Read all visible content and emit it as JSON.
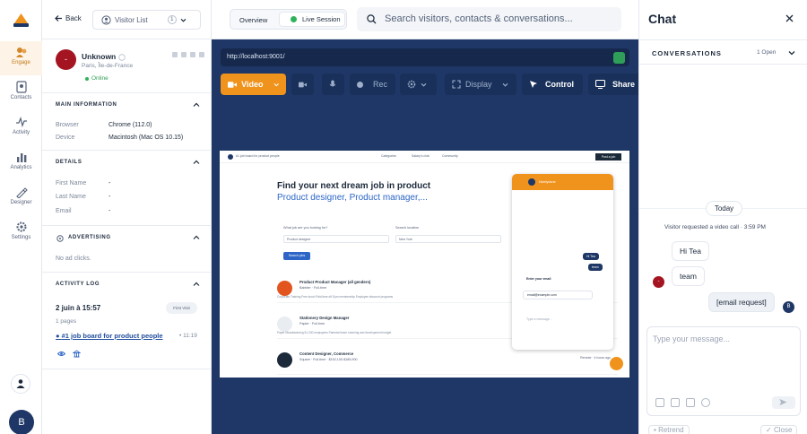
{
  "rail": {
    "items": [
      {
        "label": "Engage",
        "icon": "engage-icon"
      },
      {
        "label": "Contacts",
        "icon": "contacts-icon"
      },
      {
        "label": "Activity",
        "icon": "activity-icon"
      },
      {
        "label": "Analytics",
        "icon": "analytics-icon"
      },
      {
        "label": "Designer",
        "icon": "designer-icon"
      },
      {
        "label": "Settings",
        "icon": "settings-icon"
      }
    ],
    "avatar_initial": "B"
  },
  "visitor_panel": {
    "back_label": "Back",
    "visitor_list_label": "Visitor List",
    "visitor_list_count": "1",
    "visitor": {
      "initial": "-",
      "name": "Unknown",
      "location": "Paris, Île-de-France",
      "status": "Online"
    },
    "main_info": {
      "title": "MAIN INFORMATION",
      "rows": [
        {
          "key": "Browser",
          "value": "Chrome (112.0)"
        },
        {
          "key": "Device",
          "value": "Macintosh (Mac OS 10.15)"
        }
      ]
    },
    "details": {
      "title": "DETAILS",
      "rows": [
        {
          "key": "First Name",
          "value": "-"
        },
        {
          "key": "Last Name",
          "value": "-"
        },
        {
          "key": "Email",
          "value": "-"
        }
      ]
    },
    "advertising": {
      "title": "ADVERTISING",
      "empty": "No ad clicks."
    },
    "activity_log": {
      "title": "ACTIVITY LOG",
      "date": "2 juin à 15:57",
      "badge": "First Visit",
      "pages": "1 pages",
      "link": "#1 job board for product people",
      "time": "11:19"
    }
  },
  "topbar": {
    "overview_label": "Overview",
    "live_session_label": "Live Session",
    "search_placeholder": "Search visitors, contacts & conversations..."
  },
  "stage": {
    "url": "http://localhost:9001/",
    "toolbar": {
      "video_label": "Video",
      "rec_label": "Rec",
      "display_label": "Display",
      "control_label": "Control",
      "share_label": "Share"
    },
    "site": {
      "nav": [
        "Categories",
        "Salary's club",
        "Community"
      ],
      "post_job": "Post a job",
      "tagline": "#1 job board for product people",
      "headline": "Find your next dream job in product",
      "subheadline": "Product designer, Product manager,...",
      "search": {
        "job_label": "What job are you looking for?",
        "job_value": "Product designer",
        "location_label": "Search location",
        "location_value": "New York",
        "button": "Search jobs"
      },
      "jobs": [
        {
          "title": "Product Product Manager (all genders)",
          "company": "Babbler · Full-time",
          "tags": "Corporate Training    Free lunch    Paid time off    Gym membership    Employee discount programs",
          "right": ""
        },
        {
          "title": "Stationery Design Manager",
          "company": "Papier · Full-time",
          "tags": "Paper Manufacturing    51-200 employees    Parental leave    Learning and development budget",
          "right": ""
        },
        {
          "title": "Content Designer, Commerce",
          "company": "Square · Full-time · $152,100-$185,900",
          "tags": "",
          "right": "Remote · 4 hours ago"
        }
      ],
      "widget": {
        "agent": "Nicelydone",
        "messages": [
          "Hi Tea",
          "team"
        ],
        "email_prompt": "Enter your email",
        "email_value": "email@example.com",
        "input_ph": "Type a message..."
      }
    }
  },
  "chat": {
    "title": "Chat",
    "conversations_label": "CONVERSATIONS",
    "open_count": "1 Open",
    "day_label": "Today",
    "system_message": "Visitor requested a video call · 3:59 PM",
    "messages": [
      {
        "from": "visitor",
        "text": "Hi Tea"
      },
      {
        "from": "visitor",
        "text": "team"
      },
      {
        "from": "operator",
        "text": "[email request]"
      }
    ],
    "visitor_initial": "-",
    "operator_initial": "B",
    "composer_placeholder": "Type your message...",
    "footer_left": "Retrend",
    "footer_right": "Close"
  },
  "colors": {
    "accent": "#f0931d",
    "navy": "#1e3766",
    "online": "#2fb35a",
    "visitor_avatar": "#a41421"
  }
}
